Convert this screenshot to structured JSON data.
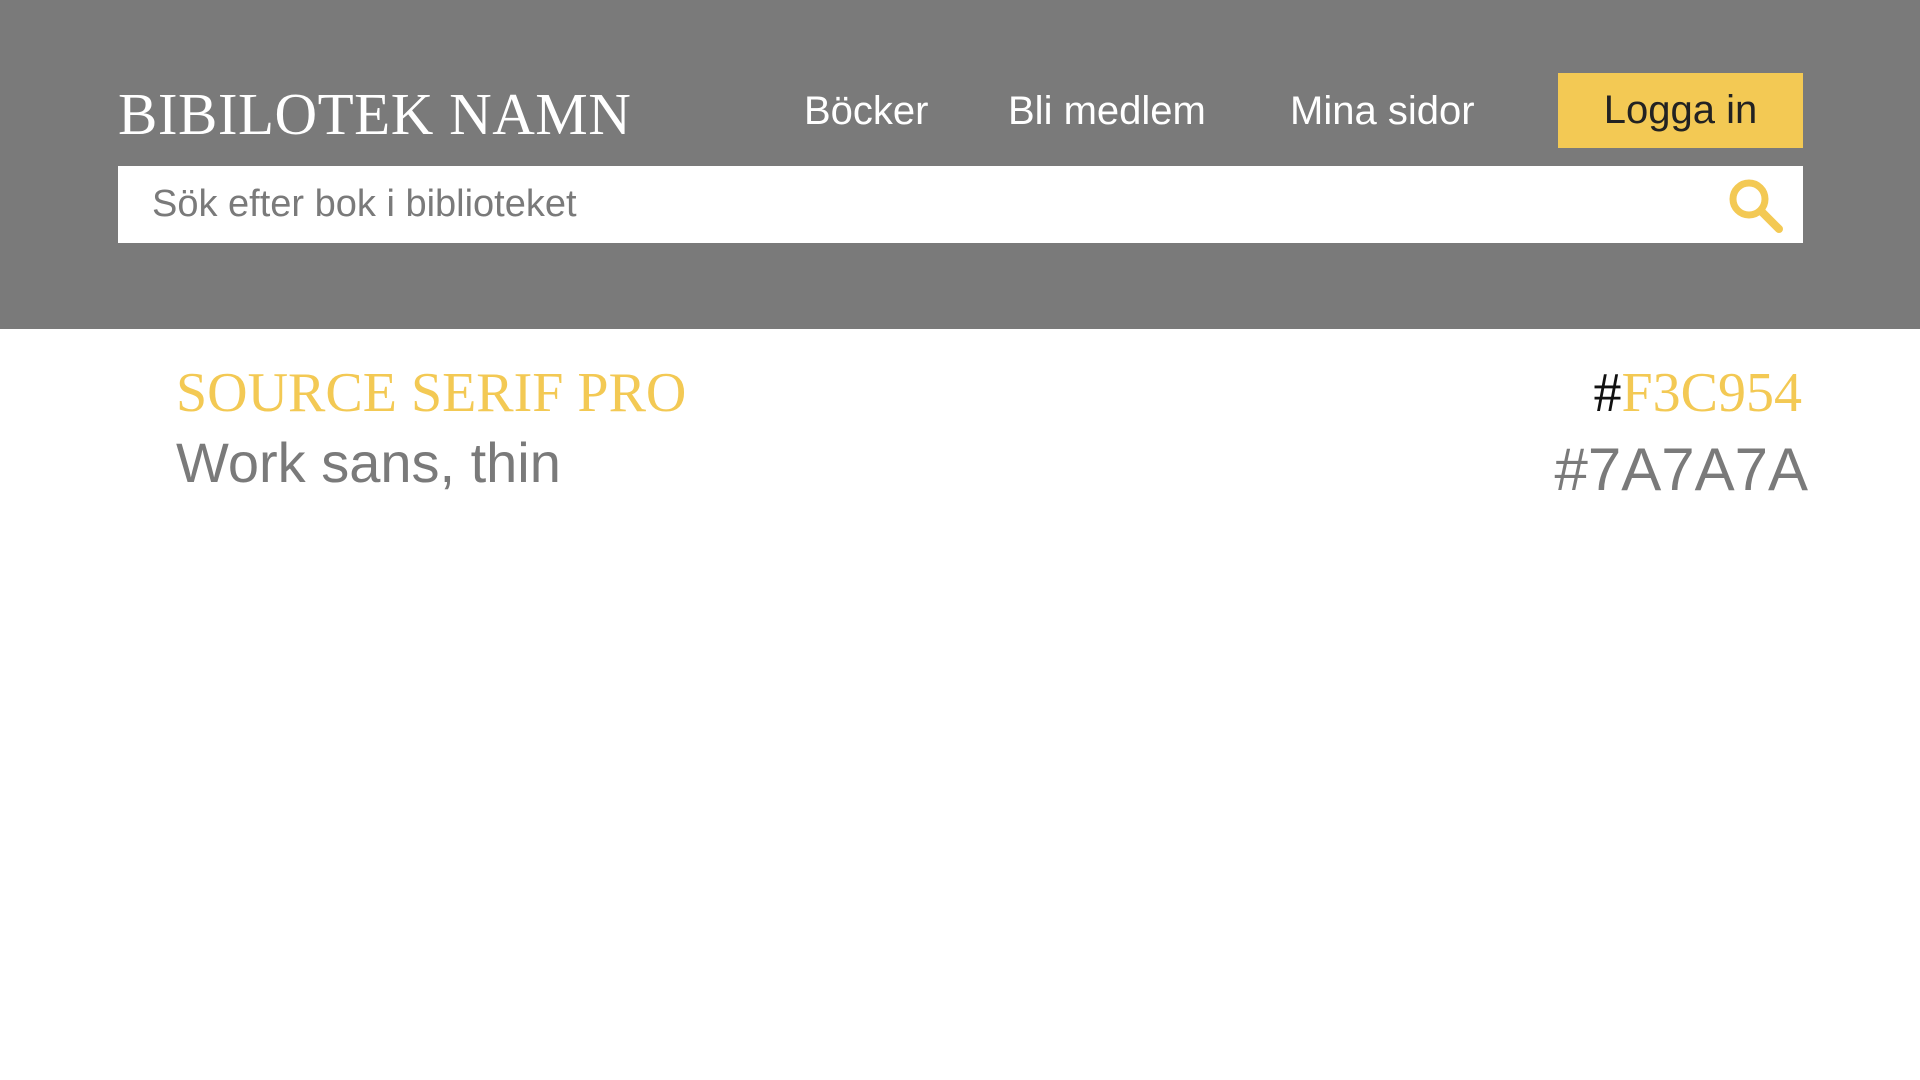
{
  "header": {
    "brand": "BIBILOTEK NAMN",
    "background_color": "#7A7A7A",
    "nav": [
      {
        "label": "Böcker"
      },
      {
        "label": "Bli medlem"
      },
      {
        "label": "Mina sidor"
      }
    ],
    "login_label": "Logga in",
    "accent_color": "#F3C954"
  },
  "search": {
    "placeholder": "Sök efter bok i biblioteket",
    "icon": "search-icon"
  },
  "style_guide": {
    "font_primary": "SOURCE SERIF PRO",
    "font_secondary": "Work sans, thin",
    "color_primary_hash": "#",
    "color_primary_code": "F3C954",
    "color_secondary": "#7A7A7A"
  }
}
